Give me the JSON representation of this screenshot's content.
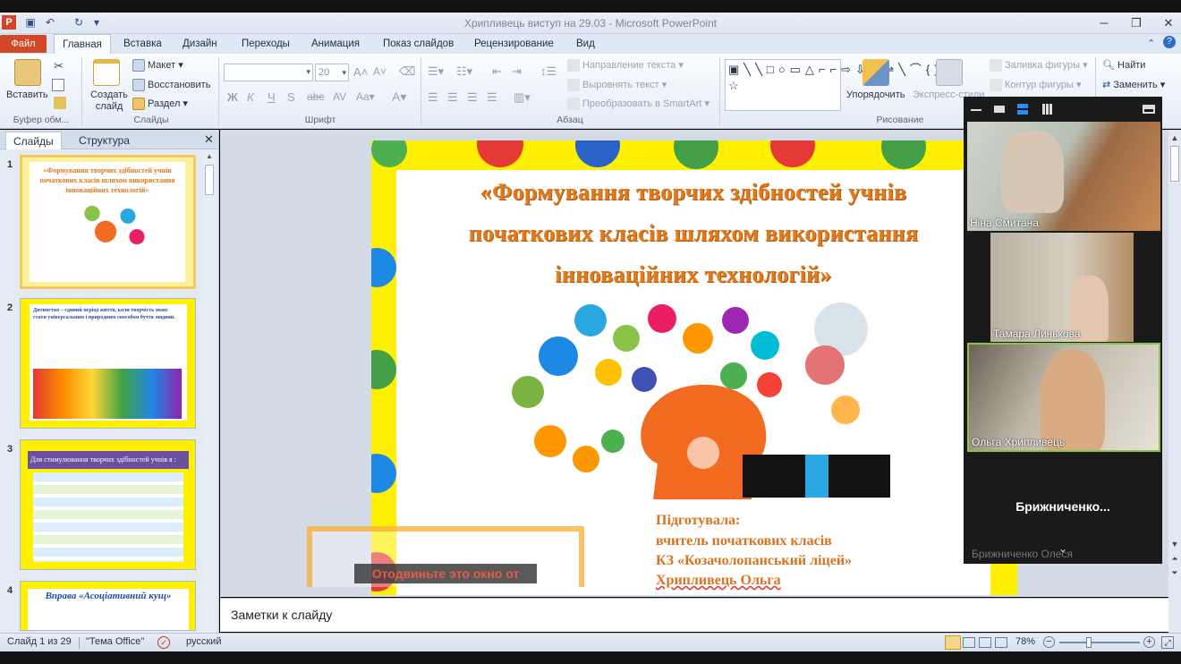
{
  "window": {
    "title": "Хрипливець виступ на 29.03 - Microsoft PowerPoint"
  },
  "tabs": [
    {
      "label": "Файл"
    },
    {
      "label": "Главная"
    },
    {
      "label": "Вставка"
    },
    {
      "label": "Дизайн"
    },
    {
      "label": "Переходы"
    },
    {
      "label": "Анимация"
    },
    {
      "label": "Показ слайдов"
    },
    {
      "label": "Рецензирование"
    },
    {
      "label": "Вид"
    }
  ],
  "ribbon": {
    "paste": "Вставить",
    "new_slide": "Создать слайд",
    "layout": "Макет",
    "reset": "Восстановить",
    "section": "Раздел",
    "font_size": "20",
    "text_direction": "Направление текста",
    "align_text": "Выровнять текст",
    "smartart": "Преобразовать в SmartArt",
    "arrange": "Упорядочить",
    "quick_styles": "Экспресс-стили",
    "shape_fill": "Заливка фигуры",
    "shape_outline": "Контур фигуры",
    "find": "Найти",
    "replace": "Заменить",
    "groups": {
      "clipboard": "Буфер обм...",
      "slides": "Слайды",
      "font": "Шрифт",
      "paragraph": "Абзац",
      "drawing": "Рисование"
    }
  },
  "panel": {
    "tab_slides": "Слайды",
    "tab_outline": "Структура"
  },
  "thumbnails": [
    {
      "num": "1",
      "title": "«Формування творчих здібностей учнів початкових класів шляхом використання інноваційних технологій»"
    },
    {
      "num": "2",
      "text": "Дитинство – єдиний період життя, коли творчість може стати універсальним і природним способом буття людини."
    },
    {
      "num": "3",
      "header": "Для стимулювання творчих здібностей учнів я :"
    },
    {
      "num": "4",
      "title": "Вправа «Асоціативний кущ»"
    }
  ],
  "slide": {
    "title_lines": [
      "«Формування творчих здібностей учнів",
      "початкових класів шляхом використання",
      "інноваційних технологій»"
    ],
    "author_lines": [
      "Підготувала:",
      "вчитель початкових класів",
      "КЗ «Козачолопанський ліцей»",
      "Хрипливець Ольга"
    ]
  },
  "overlay": {
    "message": "Отодвиньте это окно от"
  },
  "notes": {
    "placeholder": "Заметки к слайду"
  },
  "status": {
    "slide": "Слайд 1 из 29",
    "theme": "\"Тема Office\"",
    "language": "русский",
    "zoom": "78%"
  },
  "zoom_call": {
    "participants": [
      {
        "name": "Ніна Смитана"
      },
      {
        "name": "Тамара Линькова"
      },
      {
        "name": "Ольга Хрипливець"
      },
      {
        "name": "Брижниченко..."
      }
    ],
    "bottom_hidden": "Брижниченко Олеся"
  },
  "colors": {
    "accent_file": "#d24726",
    "slide_bg": "#ffef00",
    "title_orange": "#e07a1a"
  }
}
